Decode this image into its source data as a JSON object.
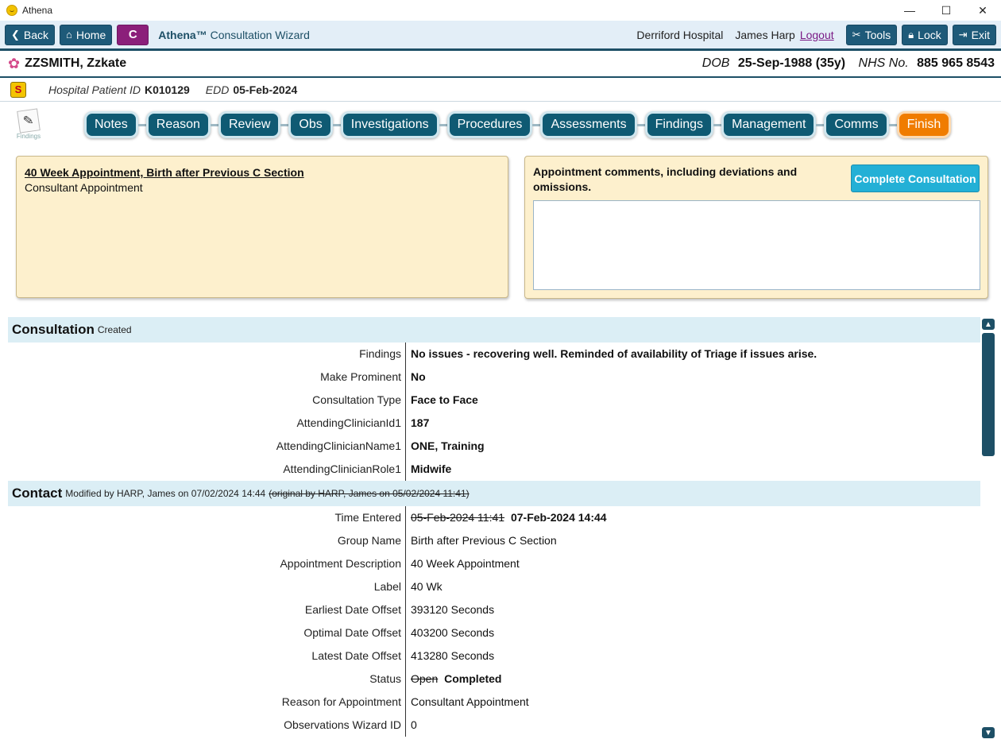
{
  "window": {
    "title": "Athena",
    "minimize": "—",
    "maximize": "☐",
    "close": "✕"
  },
  "toolbar": {
    "back": "Back",
    "home": "Home",
    "c_label": "C",
    "wizard_brand": "Athena™",
    "wizard_title": "Consultation Wizard",
    "hospital": "Derriford Hospital",
    "user": "James Harp",
    "logout": "Logout",
    "tools": "Tools",
    "lock": "Lock",
    "exit": "Exit"
  },
  "patient": {
    "name": "ZZSMITH, Zzkate",
    "dob_label": "DOB",
    "dob_value": "25-Sep-1988 (35y)",
    "nhs_label": "NHS No.",
    "nhs_value": "885 965 8543",
    "hospital_id_label": "Hospital Patient ID",
    "hospital_id_value": "K010129",
    "edd_label": "EDD",
    "edd_value": "05-Feb-2024"
  },
  "nav": {
    "icon_label": "Findings",
    "tabs": [
      "Notes",
      "Reason",
      "Review",
      "Obs",
      "Investigations",
      "Procedures",
      "Assessments",
      "Findings",
      "Management",
      "Comms"
    ],
    "finish": "Finish"
  },
  "appointment": {
    "title": "40 Week Appointment, Birth after Previous C Section",
    "subtitle": "Consultant Appointment"
  },
  "comments": {
    "label": "Appointment comments, including deviations and omissions.",
    "complete_button": "Complete Consultation",
    "value": ""
  },
  "consultation": {
    "title": "Consultation",
    "status": "Created",
    "rows": [
      {
        "key": "Findings",
        "value": "No issues - recovering well. Reminded of availability of Triage if issues arise."
      },
      {
        "key": "Make Prominent",
        "value": "No"
      },
      {
        "key": "Consultation Type",
        "value": "Face to Face"
      },
      {
        "key": "AttendingClinicianId1",
        "value": "187"
      },
      {
        "key": "AttendingClinicianName1",
        "value": "ONE, Training"
      },
      {
        "key": "AttendingClinicianRole1",
        "value": "Midwife"
      }
    ]
  },
  "contact": {
    "title": "Contact",
    "modified": "Modified by HARP, James on 07/02/2024 14:44",
    "original": "(original by HARP, James on 05/02/2024 11:41)",
    "time_entered_key": "Time Entered",
    "time_entered_old": "05-Feb-2024 11:41",
    "time_entered_new": "07-Feb-2024 14:44",
    "group_name_key": "Group Name",
    "group_name": "Birth after Previous C Section",
    "appt_desc_key": "Appointment Description",
    "appt_desc": "40 Week Appointment",
    "label_key": "Label",
    "label": "40 Wk",
    "earliest_key": "Earliest Date Offset",
    "earliest": "393120 Seconds",
    "optimal_key": "Optimal Date Offset",
    "optimal": "403200 Seconds",
    "latest_key": "Latest Date Offset",
    "latest": "413280 Seconds",
    "status_key": "Status",
    "status_old": "Open",
    "status_new": "Completed",
    "reason_key": "Reason for Appointment",
    "reason": "Consultant Appointment",
    "obs_key": "Observations Wizard ID",
    "obs": "0"
  },
  "scrollbar": {
    "up": "▲",
    "down": "▼"
  }
}
